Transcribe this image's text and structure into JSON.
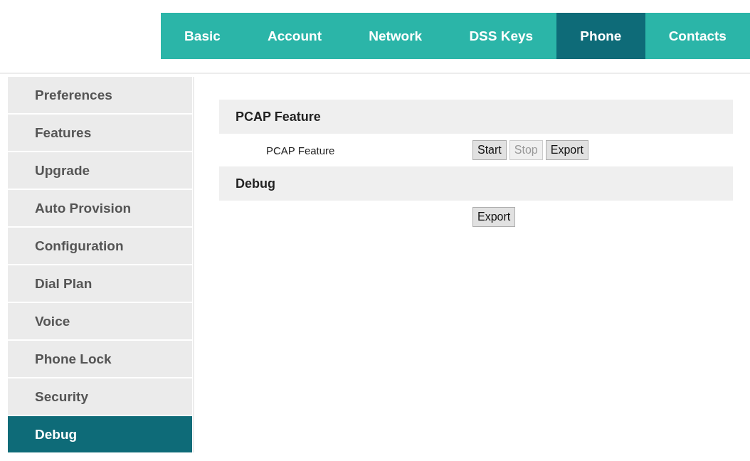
{
  "nav_tabs": [
    {
      "label": "Basic",
      "selected": false
    },
    {
      "label": "Account",
      "selected": false
    },
    {
      "label": "Network",
      "selected": false
    },
    {
      "label": "DSS Keys",
      "selected": false
    },
    {
      "label": "Phone",
      "selected": true
    },
    {
      "label": "Contacts",
      "selected": false
    }
  ],
  "sidebar": {
    "items": [
      {
        "label": "Preferences",
        "selected": false
      },
      {
        "label": "Features",
        "selected": false
      },
      {
        "label": "Upgrade",
        "selected": false
      },
      {
        "label": "Auto Provision",
        "selected": false
      },
      {
        "label": "Configuration",
        "selected": false
      },
      {
        "label": "Dial Plan",
        "selected": false
      },
      {
        "label": "Voice",
        "selected": false
      },
      {
        "label": "Phone Lock",
        "selected": false
      },
      {
        "label": "Security",
        "selected": false
      },
      {
        "label": "Debug",
        "selected": true
      }
    ]
  },
  "sections": [
    {
      "title": "PCAP Feature",
      "rows": [
        {
          "label": "PCAP Feature",
          "buttons": [
            {
              "label": "Start",
              "disabled": false
            },
            {
              "label": "Stop",
              "disabled": true
            },
            {
              "label": "Export",
              "disabled": false
            }
          ]
        }
      ]
    },
    {
      "title": "Debug",
      "rows": [
        {
          "buttons": [
            {
              "label": "Export",
              "disabled": false
            }
          ]
        }
      ]
    }
  ]
}
